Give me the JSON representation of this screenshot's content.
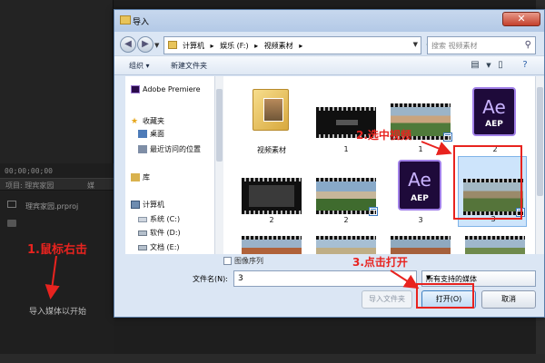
{
  "premiere": {
    "timecode": "00;00;00;00",
    "tab_project": "项目: 理宾家园",
    "tab_other": "媒",
    "project_file": "理宾家园.prproj",
    "empty_hint": "导入媒体以开始"
  },
  "dialog": {
    "title": "导入",
    "close_label": "✕",
    "address": {
      "crumbs": [
        "计算机",
        "▸",
        "娱乐 (F:)",
        "▸",
        "视频素材",
        "▸"
      ]
    },
    "search_placeholder": "搜索 视频素材",
    "toolbar": {
      "organize": "组织 ▾",
      "new_folder": "新建文件夹"
    },
    "nav_pane": [
      {
        "label": "Adobe Premiere",
        "icon": "premiere-icon"
      },
      {
        "label": "收藏夹",
        "icon": "star-icon"
      },
      {
        "label": "桌面",
        "icon": "desktop-icon"
      },
      {
        "label": "最近访问的位置",
        "icon": "recent-places-icon"
      },
      {
        "label": "库",
        "icon": "library-icon"
      },
      {
        "label": "计算机",
        "icon": "computer-icon"
      },
      {
        "label": "系统 (C:)",
        "icon": "drive-icon"
      },
      {
        "label": "软件 (D:)",
        "icon": "drive-icon"
      },
      {
        "label": "文档 (E:)",
        "icon": "drive-icon"
      }
    ],
    "files": [
      {
        "label": "视频素材",
        "kind": "folder"
      },
      {
        "label": "1",
        "kind": "video-dark"
      },
      {
        "label": "1",
        "kind": "video-castle"
      },
      {
        "label": "2",
        "kind": "aep"
      },
      {
        "label": "2",
        "kind": "video-dark"
      },
      {
        "label": "2",
        "kind": "video-castle"
      },
      {
        "label": "3",
        "kind": "aep"
      },
      {
        "label": "3",
        "kind": "video-castle",
        "selected": true
      },
      {
        "label": "",
        "kind": "video-castle"
      },
      {
        "label": "",
        "kind": "video-castle"
      },
      {
        "label": "",
        "kind": "video-castle"
      },
      {
        "label": "",
        "kind": "video-castle"
      }
    ],
    "aep_text": "Ae",
    "aep_ext": "AEP",
    "image_sequence_label": "图像序列",
    "filename_label": "文件名(N):",
    "filename_value": "3",
    "filetype_value": "所有支持的媒体",
    "buttons": {
      "import_folder": "导入文件夹",
      "open": "打开(O)",
      "cancel": "取消"
    }
  },
  "annotations": {
    "step1": "1.鼠标右击",
    "step2": "2.选中视频",
    "step3": "3.点击打开"
  },
  "colors": {
    "annotation": "#e8231f",
    "dialog_bg": "#dbe6f4",
    "selection": "#cde4fb"
  }
}
